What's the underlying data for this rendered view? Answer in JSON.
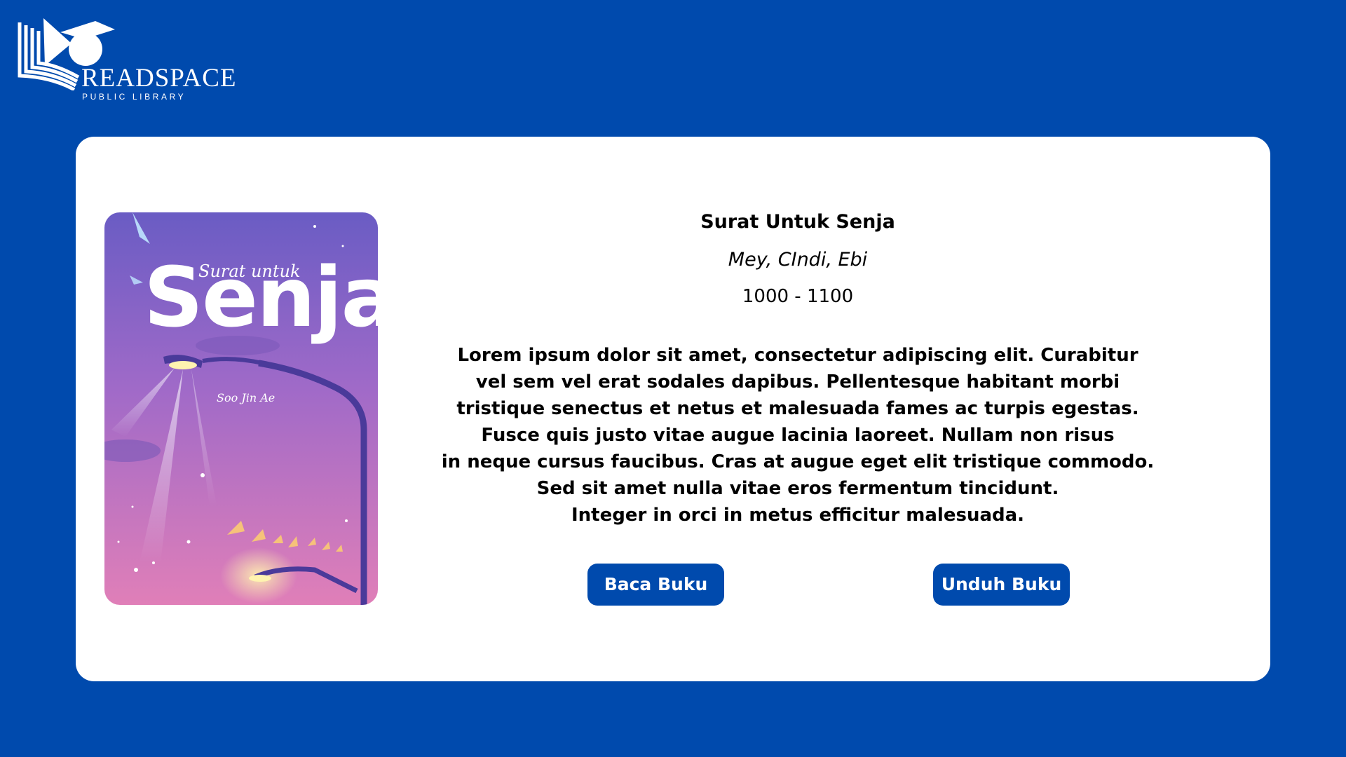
{
  "brand": {
    "name": "READSPACE",
    "tagline": "PUBLIC LIBRARY",
    "logo_icon": "open-book-with-graduation-cap-icon"
  },
  "book": {
    "title": "Surat Untuk Senja",
    "authors": "Mey, CIndi, Ebi",
    "range": "1000 - 1100",
    "description": "Lorem ipsum dolor sit amet, consectetur adipiscing elit. Curabitur\nvel sem vel erat sodales dapibus. Pellentesque habitant morbi\ntristique senectus et netus et malesuada fames ac turpis egestas.\nFusce quis justo vitae augue lacinia laoreet. Nullam non risus\nin neque cursus faucibus. Cras at augue eget elit tristique commodo.\nSed sit amet nulla vitae eros fermentum tincidunt.\nInteger in orci in metus efficitur malesuada.",
    "cover": {
      "title_small": "Surat untuk",
      "title_big": "Senja",
      "author": "Soo Jin Ae"
    }
  },
  "actions": {
    "read_label": "Baca Buku",
    "download_label": "Unduh Buku"
  },
  "colors": {
    "background": "#004aad",
    "card": "#ffffff",
    "button": "#004aad",
    "button_text": "#ffffff",
    "cover_top": "#6a5cc4",
    "cover_bottom": "#e07fb8"
  }
}
